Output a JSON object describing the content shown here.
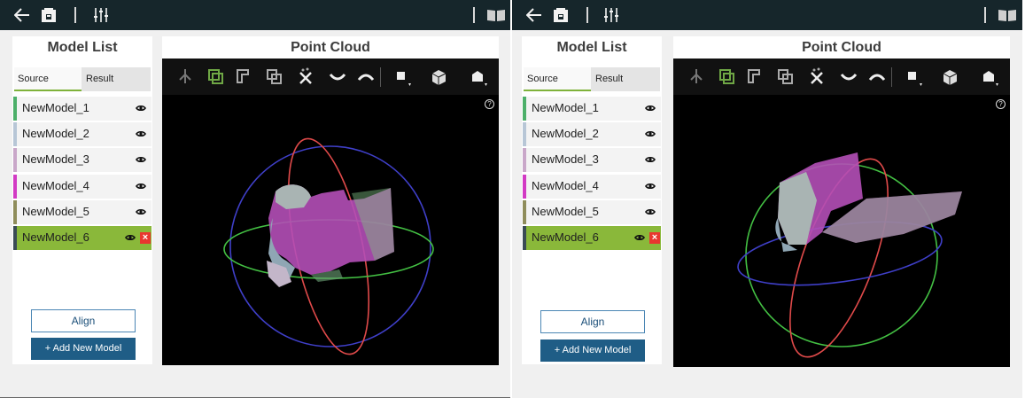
{
  "screens": [
    {
      "model_list": {
        "title": "Model List",
        "tabs": [
          "Source",
          "Result"
        ],
        "items": [
          {
            "label": "NewModel_1",
            "color": "#4caf69"
          },
          {
            "label": "NewModel_2",
            "color": "#b7c6d6"
          },
          {
            "label": "NewModel_3",
            "color": "#c9a7c9"
          },
          {
            "label": "NewModel_4",
            "color": "#d23ac4"
          },
          {
            "label": "NewModel_5",
            "color": "#8f8d5b"
          },
          {
            "label": "NewModel_6",
            "color": "#3a4b55",
            "selected": true
          }
        ],
        "align_label": "Align",
        "add_label": "+ Add New Model"
      },
      "point_cloud": {
        "title": "Point Cloud",
        "help": "?"
      }
    },
    {
      "model_list": {
        "title": "Model List",
        "tabs": [
          "Source",
          "Result"
        ],
        "items": [
          {
            "label": "NewModel_1",
            "color": "#4caf69"
          },
          {
            "label": "NewModel_2",
            "color": "#b7c6d6"
          },
          {
            "label": "NewModel_3",
            "color": "#c9a7c9"
          },
          {
            "label": "NewModel_4",
            "color": "#d23ac4"
          },
          {
            "label": "NewModel_5",
            "color": "#8f8d5b"
          },
          {
            "label": "NewModel_6",
            "color": "#3a4b55",
            "selected": true
          }
        ],
        "align_label": "Align",
        "add_label": "+ Add New Model"
      },
      "point_cloud": {
        "title": "Point Cloud",
        "help": "?"
      }
    }
  ],
  "icons": {
    "topbar": [
      "back-arrow-icon",
      "save-icon",
      "settings-sliders-icon",
      "book-icon"
    ],
    "toolbar": [
      "cursor-icon",
      "copy-icon",
      "crop-icon",
      "duplicate-icon",
      "delete-points-icon",
      "curve-down-icon",
      "curve-up-icon",
      "point-size-icon",
      "cube-icon",
      "view-icon"
    ]
  },
  "colors": {
    "topbar": "#16262b",
    "accent": "#8ab83a",
    "primary_button": "#1f5d86",
    "delete": "#e8372f"
  }
}
